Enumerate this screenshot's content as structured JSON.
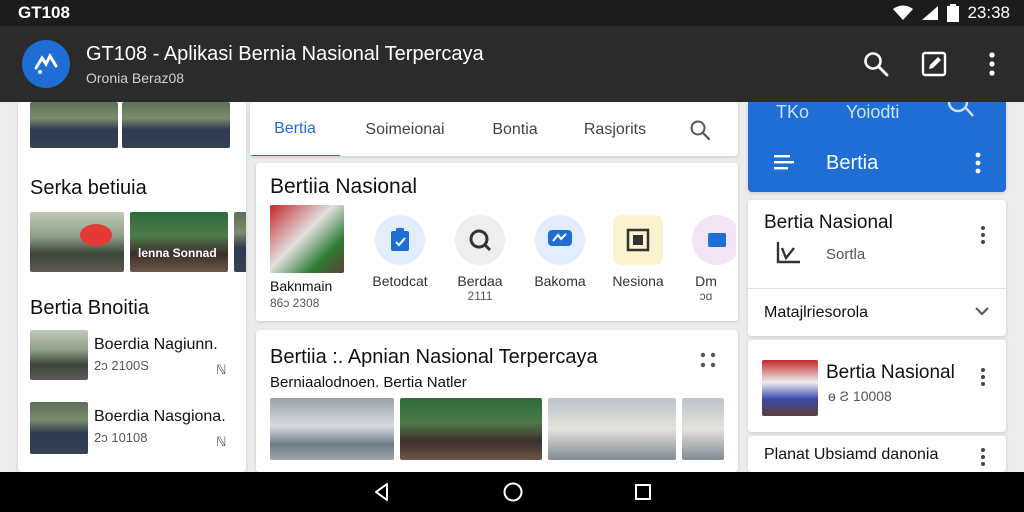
{
  "status": {
    "carrier": "GT108",
    "time": "23:38"
  },
  "appbar": {
    "title": "GT108 - Aplikasi Bernia Nasional Terpercaya",
    "subtitle": "Oronia Beraz08"
  },
  "left": {
    "section1_title": "Serka betiuia",
    "photo_caption": "lenna Sonnad",
    "section2_title": "Bertia Bnoitia",
    "items": [
      {
        "title": "Boerdia Nagiunn.",
        "meta": "2ɔ 2100S",
        "badge": "ℕ"
      },
      {
        "title": "Boerdia Nasgiona.",
        "meta": "2ɔ 10108",
        "badge": "ℕ"
      }
    ]
  },
  "tabs": [
    {
      "label": "Bertia"
    },
    {
      "label": "Soimeionai"
    },
    {
      "label": "Bontia"
    },
    {
      "label": "Rasjorits"
    }
  ],
  "nasional": {
    "title": "Bertiia Nasional",
    "feature": {
      "label": "Baknmain",
      "meta": "86ɔ 2308"
    },
    "categories": [
      {
        "label": "Betodcat",
        "meta": ""
      },
      {
        "label": "Berdaa",
        "meta": "2111"
      },
      {
        "label": "Bakoma",
        "meta": ""
      },
      {
        "label": "Nesiona",
        "meta": ""
      },
      {
        "label": "Dm",
        "meta": "ɔɑ"
      }
    ]
  },
  "headline": {
    "title": "Bertiia :. Apnian Nasional Terpercaya",
    "subtitle": "Berniaalodnoen. Bertia Natler"
  },
  "right": {
    "top_labels": [
      "TKo",
      "Yoiodti"
    ],
    "bar_title": "Bertia",
    "card1": {
      "title": "Bertia Nasional",
      "sub": "Sortla"
    },
    "dropdown": "Matajlriesorola",
    "card2": {
      "title": "Bertia Nasional",
      "meta": "ɵ Ƨ 10008"
    },
    "card3": {
      "title": "Planat Ubsiamd danonia"
    }
  },
  "colors": {
    "accent": "#1e6ed6",
    "appbar": "#2b2b2b",
    "statusbar": "#1c1c1c"
  }
}
